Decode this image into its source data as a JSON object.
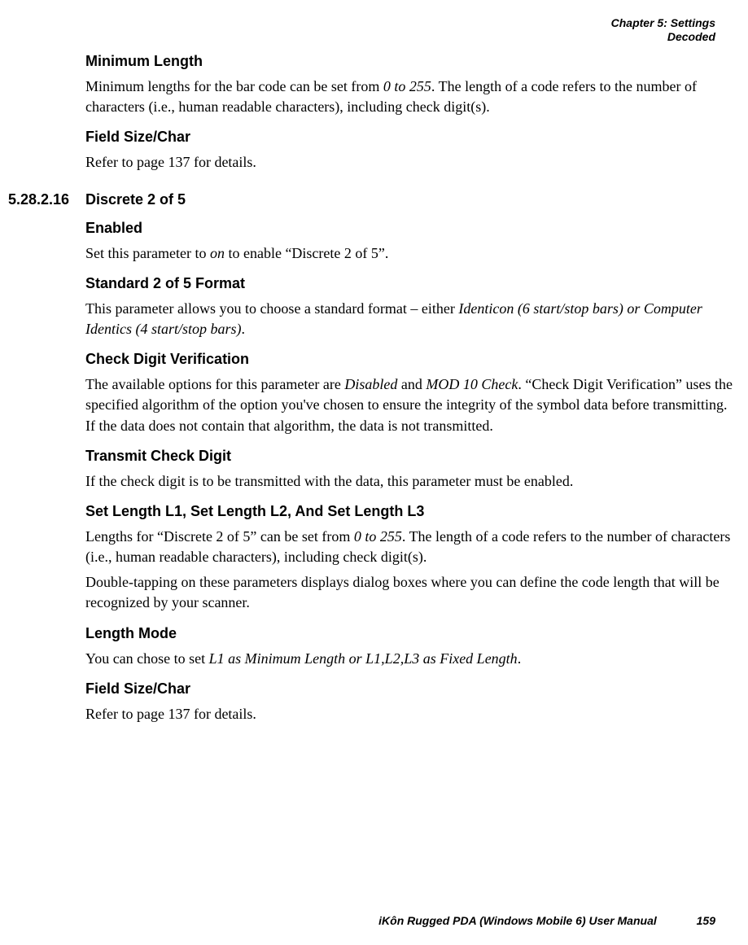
{
  "header": {
    "line1": "Chapter 5: Settings",
    "line2": "Decoded"
  },
  "sections": {
    "minLength": {
      "title": "Minimum Length",
      "body_pre": "Minimum lengths for the bar code can be set from ",
      "body_italic": "0 to 255",
      "body_post": ". The length of a code refers to the number of characters (i.e., human readable characters), including check digit(s)."
    },
    "fieldSize1": {
      "title": "Field Size/Char",
      "body": "Refer to page 137 for details."
    },
    "discrete": {
      "number": "5.28.2.16",
      "title": "Discrete 2 of 5"
    },
    "enabled": {
      "title": "Enabled",
      "body_pre": "Set this parameter to ",
      "body_italic": "on",
      "body_post": " to enable “Discrete 2 of 5”."
    },
    "standardFormat": {
      "title": "Standard 2 of 5 Format",
      "body_pre": "This parameter allows you to choose a standard format – either ",
      "body_italic": "Identicon (6 start/stop bars) or Computer Identics (4 start/stop bars)",
      "body_post": "."
    },
    "checkDigit": {
      "title": "Check Digit Verification",
      "body_pre": "The available options for this parameter are ",
      "body_italic1": "Disabled",
      "body_mid": " and ",
      "body_italic2": "MOD 10 Check",
      "body_post": ". “Check Digit Verification” uses the specified algorithm of the option you've chosen to ensure the integrity of the symbol data before transmitting. If the data does not contain that algorithm, the data is not transmitted."
    },
    "transmitCheck": {
      "title": "Transmit Check Digit",
      "body": "If the check digit is to be transmitted with the data, this parameter must be enabled."
    },
    "setLength": {
      "title": "Set Length L1, Set Length L2, And Set Length L3",
      "body1_pre": "Lengths for “Discrete 2 of 5” can be set from ",
      "body1_italic": "0 to 255",
      "body1_post": ". The length of a code refers to the number of characters (i.e., human readable characters), including check digit(s).",
      "body2": "Double-tapping on these parameters displays dialog boxes where you can define the code length that will be recognized by your scanner."
    },
    "lengthMode": {
      "title": "Length Mode",
      "body_pre": "You can chose to set ",
      "body_italic": "L1 as Minimum Length or L1,L2,L3 as Fixed Length",
      "body_post": "."
    },
    "fieldSize2": {
      "title": "Field Size/Char",
      "body": "Refer to page 137 for details."
    }
  },
  "footer": {
    "text": "iKôn Rugged PDA (Windows Mobile 6) User Manual",
    "page": "159"
  }
}
